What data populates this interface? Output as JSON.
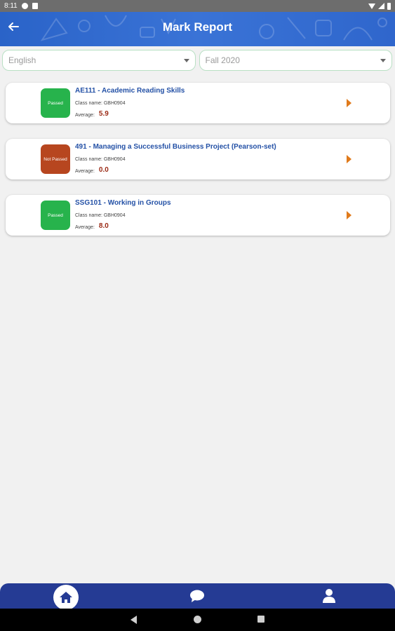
{
  "status_bar": {
    "time": "8:11"
  },
  "app_bar": {
    "title": "Mark Report",
    "back_icon": "arrow-left-icon"
  },
  "filters": {
    "language": {
      "value": "English"
    },
    "term": {
      "value": "Fall 2020"
    }
  },
  "colors": {
    "primary": "#2f66cc",
    "passed": "#27b34c",
    "not_passed": "#b7461f",
    "arrow": "#e07a1b",
    "nav": "#253b94"
  },
  "reports": [
    {
      "status": "Passed",
      "status_type": "pass",
      "title": "AE111 - Academic Reading Skills",
      "class_line": "Class name: GBH0904",
      "average_label": "Average:",
      "average": "5.9"
    },
    {
      "status": "Not Passed",
      "status_type": "fail",
      "title": "491 - Managing a Successful Business Project (Pearson-set)",
      "class_line": "Class name: GBH0904",
      "average_label": "Average:",
      "average": "0.0"
    },
    {
      "status": "Passed",
      "status_type": "pass",
      "title": "SSG101 - Working in Groups",
      "class_line": "Class name: GBH0904",
      "average_label": "Average:",
      "average": "8.0"
    }
  ],
  "bottom_nav": {
    "items": [
      "home-icon",
      "chat-icon",
      "profile-icon"
    ],
    "active": "home-icon"
  }
}
